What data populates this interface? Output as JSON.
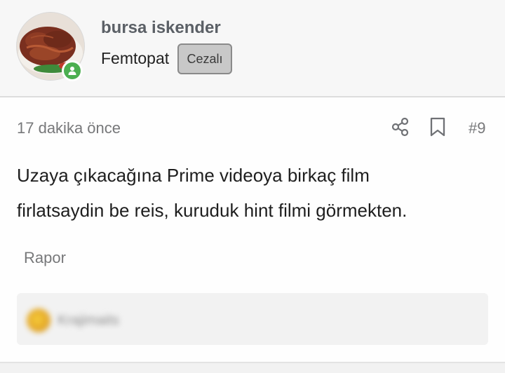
{
  "user": {
    "name": "bursa iskender",
    "title": "Femtopat",
    "badge": "Cezalı",
    "online": true
  },
  "post": {
    "time": "17 dakika önce",
    "number": "#9",
    "body_line1": "Uzaya çıkacağına Prime videoya birkaç film",
    "body_line2": "firlatsaydin be reis, kuruduk hint filmi görmekten.",
    "report_label": "Rapor"
  },
  "reactions": {
    "name": "Krajimaits"
  },
  "icons": {
    "share": "share-icon",
    "bookmark": "bookmark-icon",
    "online": "user-online-icon"
  },
  "colors": {
    "online_green": "#4caf50",
    "badge_bg": "#c8c8c8",
    "username": "#5b6066",
    "muted_text": "#77787a"
  }
}
